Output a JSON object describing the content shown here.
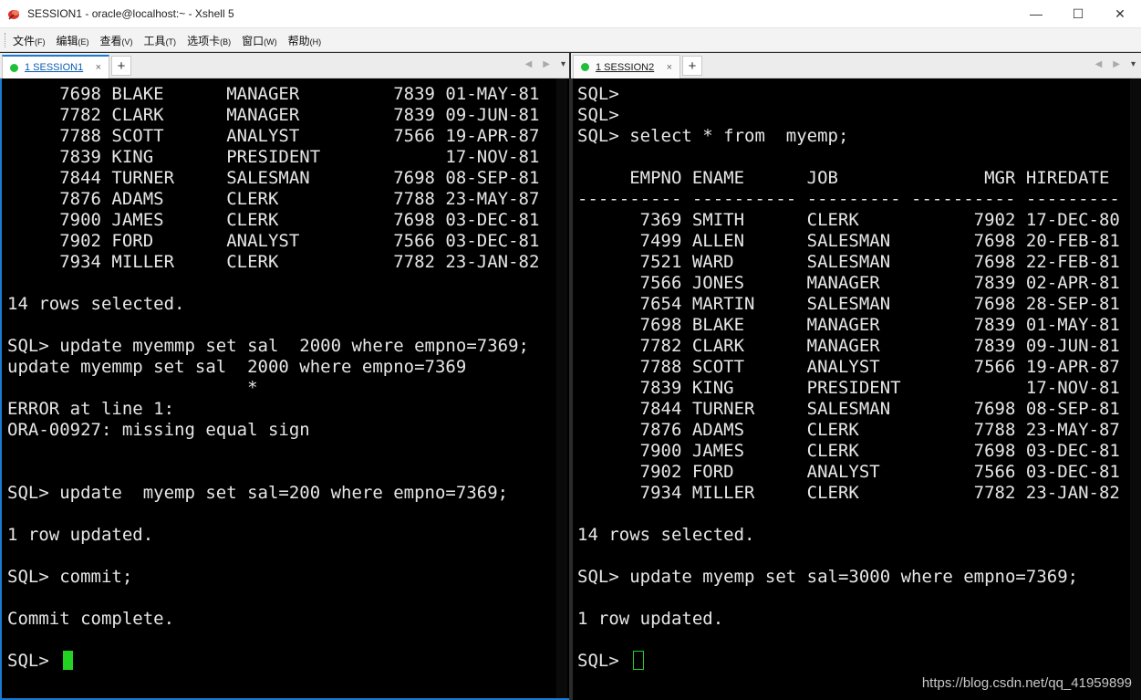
{
  "window": {
    "title": "SESSION1 - oracle@localhost:~ - Xshell 5",
    "controls": {
      "minimize": "—",
      "maximize": "☐",
      "close": "✕"
    }
  },
  "menu": [
    {
      "label": "文件",
      "accel": "(F)"
    },
    {
      "label": "编辑",
      "accel": "(E)"
    },
    {
      "label": "查看",
      "accel": "(V)"
    },
    {
      "label": "工具",
      "accel": "(T)"
    },
    {
      "label": "选项卡",
      "accel": "(B)"
    },
    {
      "label": "窗口",
      "accel": "(W)"
    },
    {
      "label": "帮助",
      "accel": "(H)"
    }
  ],
  "left_pane": {
    "tab_label": "1 SESSION1",
    "tab_close": "×",
    "add_tab": "+",
    "nav": {
      "prev": "◀",
      "next": "▶",
      "drop": "▾"
    },
    "lines": [
      "     7698 BLAKE      MANAGER         7839 01-MAY-81",
      "     7782 CLARK      MANAGER         7839 09-JUN-81",
      "     7788 SCOTT      ANALYST         7566 19-APR-87",
      "     7839 KING       PRESIDENT            17-NOV-81",
      "     7844 TURNER     SALESMAN        7698 08-SEP-81",
      "     7876 ADAMS      CLERK           7788 23-MAY-87",
      "     7900 JAMES      CLERK           7698 03-DEC-81",
      "     7902 FORD       ANALYST         7566 03-DEC-81",
      "     7934 MILLER     CLERK           7782 23-JAN-82",
      "",
      "14 rows selected.",
      "",
      "SQL> update myemmp set sal  2000 where empno=7369;",
      "update myemmp set sal  2000 where empno=7369",
      "                       *",
      "ERROR at line 1:",
      "ORA-00927: missing equal sign",
      "",
      "",
      "SQL> update  myemp set sal=200 where empno=7369;",
      "",
      "1 row updated.",
      "",
      "SQL> commit;",
      "",
      "Commit complete.",
      ""
    ],
    "prompt": "SQL> "
  },
  "right_pane": {
    "tab_label": "1 SESSION2",
    "tab_close": "×",
    "add_tab": "+",
    "nav": {
      "prev": "◀",
      "next": "▶",
      "drop": "▾"
    },
    "lines": [
      "SQL>",
      "SQL>",
      "SQL> select * from  myemp;",
      "",
      "     EMPNO ENAME      JOB              MGR HIREDATE",
      "---------- ---------- --------- ---------- --------- --",
      "      7369 SMITH      CLERK           7902 17-DEC-80",
      "      7499 ALLEN      SALESMAN        7698 20-FEB-81",
      "      7521 WARD       SALESMAN        7698 22-FEB-81",
      "      7566 JONES      MANAGER         7839 02-APR-81",
      "      7654 MARTIN     SALESMAN        7698 28-SEP-81",
      "      7698 BLAKE      MANAGER         7839 01-MAY-81",
      "      7782 CLARK      MANAGER         7839 09-JUN-81",
      "      7788 SCOTT      ANALYST         7566 19-APR-87",
      "      7839 KING       PRESIDENT            17-NOV-81",
      "      7844 TURNER     SALESMAN        7698 08-SEP-81",
      "      7876 ADAMS      CLERK           7788 23-MAY-87",
      "      7900 JAMES      CLERK           7698 03-DEC-81",
      "      7902 FORD       ANALYST         7566 03-DEC-81",
      "      7934 MILLER     CLERK           7782 23-JAN-82",
      "",
      "14 rows selected.",
      "",
      "SQL> update myemp set sal=3000 where empno=7369;",
      "",
      "1 row updated.",
      ""
    ],
    "prompt": "SQL> ",
    "watermark": "https://blog.csdn.net/qq_41959899"
  },
  "colors": {
    "terminal_bg": "#000000",
    "terminal_fg": "#e6e6e6",
    "cursor": "#22d322",
    "active_tab_accent": "#1a7ad4",
    "session_dot": "#1fbf3a"
  },
  "icons": {
    "app": "xshell-icon",
    "session_status": "connected-dot-icon"
  }
}
